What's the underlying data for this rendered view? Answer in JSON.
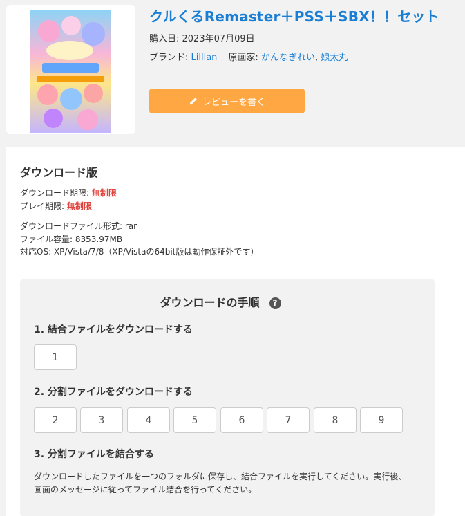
{
  "product": {
    "title": "クルくるRemaster＋PSS＋SBX！！セット",
    "purchase_label": "購入日: ",
    "purchase_date": "2023年07月09日",
    "brand_label": "ブランド: ",
    "brand": "Lillian",
    "artist_label": "原画家: ",
    "artists": [
      "かんなぎれい",
      "娘太丸"
    ],
    "artist_sep": ", ",
    "review_button": "レビューを書く"
  },
  "download": {
    "section_title": "ダウンロード版",
    "limit_label": "ダウンロード期限: ",
    "limit_value": "無制限",
    "play_label": "プレイ期限: ",
    "play_value": "無制限",
    "format_line": "ダウンロードファイル形式: rar",
    "size_line": "ファイル容量: 8353.97MB",
    "os_line": "対応OS: XP/Vista/7/8（XP/Vistaの64bit版は動作保証外です）"
  },
  "steps": {
    "title": "ダウンロードの手順",
    "help": "?",
    "step1_label": "1. 結合ファイルをダウンロードする",
    "step1_files": [
      "1"
    ],
    "step2_label": "2. 分割ファイルをダウンロードする",
    "step2_files": [
      "2",
      "3",
      "4",
      "5",
      "6",
      "7",
      "8",
      "9"
    ],
    "step3_label": "3. 分割ファイルを結合する",
    "step3_desc": "ダウンロードしたファイルを一つのフォルダに保存し、結合ファイルを実行してください。実行後、画面のメッセージに従ってファイル結合を行ってください。"
  },
  "colors": {
    "link": "#1a7fd4",
    "accent_button": "#ffa843",
    "emphasis": "#e0443e"
  }
}
